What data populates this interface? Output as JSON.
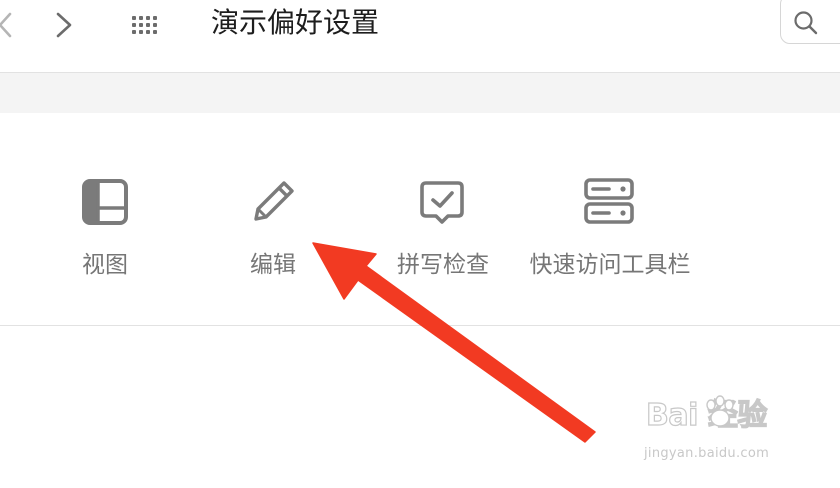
{
  "window": {
    "title": "演示偏好设置"
  },
  "titlebar": {
    "back_icon": "chevron-left-icon",
    "forward_icon": "chevron-right-icon",
    "grid_icon": "show-all-grid-icon",
    "search_icon": "magnifier-icon"
  },
  "search": {
    "placeholder": ""
  },
  "tabs": [
    {
      "id": "view",
      "label": "视图",
      "icon": "sidebar-layout-icon"
    },
    {
      "id": "edit",
      "label": "编辑",
      "icon": "pencil-icon"
    },
    {
      "id": "spell",
      "label": "拼写检查",
      "icon": "speech-checkmark-icon"
    },
    {
      "id": "quick",
      "label": "快速访问工具栏",
      "icon": "server-rack-icon"
    }
  ],
  "annotation": {
    "type": "arrow",
    "color": "#f23a22",
    "points_to": "编辑"
  },
  "watermark": {
    "brand": "Bai 经验",
    "url": "jingyan.baidu.com"
  },
  "colors": {
    "icon_gray": "#7b7b7b",
    "label_gray": "#767676",
    "title_text": "#1d1d1d",
    "band_gray": "#f4f4f4",
    "arrow_red": "#f23a22"
  }
}
